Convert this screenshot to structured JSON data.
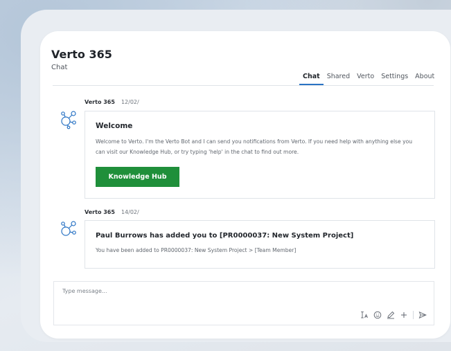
{
  "app": {
    "title": "Verto 365",
    "subtitle": "Chat"
  },
  "tabs": [
    {
      "label": "Chat",
      "active": true
    },
    {
      "label": "Shared"
    },
    {
      "label": "Verto"
    },
    {
      "label": "Settings"
    },
    {
      "label": "About"
    }
  ],
  "messages": [
    {
      "sender": "Verto 365",
      "date": "12/02/",
      "title": "Welcome",
      "body": "Welcome to Verto. I'm the Verto Bot and I can send you notifications from Verto. If you need help with anything else you can visit our Knowledge Hub, or try typing 'help' in the chat to find out more.",
      "button_label": "Knowledge Hub"
    },
    {
      "sender": "Verto 365",
      "date": "14/02/",
      "title": "Paul Burrows has added you to [PR0000037: New System Project]",
      "body": "You have been added to PR0000037: New System Project > [Team Member]"
    }
  ],
  "composer": {
    "placeholder": "Type message..."
  },
  "colors": {
    "accent": "#2a73c4",
    "button": "#1f8f3a",
    "avatar": "#2a73c4"
  }
}
